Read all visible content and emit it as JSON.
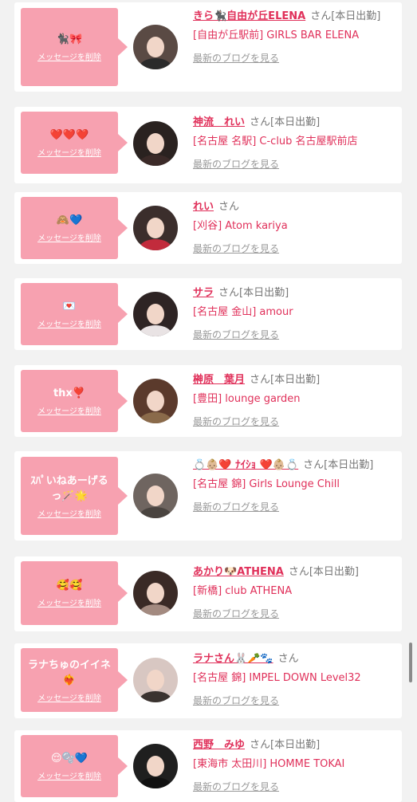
{
  "delete_label": "メッセージを削除",
  "blog_label": "最新のブログを見る",
  "colors": {
    "accent": "#e0305a",
    "bubble": "#f7a1b0",
    "muted": "#777777",
    "card": "#ffffff",
    "background": "#f2f2f2"
  },
  "items": [
    {
      "message": "🐈‍⬛🎀",
      "name": "きら🐈‍⬛自由が丘ELENA",
      "suffix": "さん[本日出勤]",
      "shop": "[自由が丘駅前] GIRLS BAR ELENA",
      "avatar_hair": "#5a4a44",
      "avatar_body": "#2b2b2b"
    },
    {
      "message": "❤️❤️❤️",
      "name": "神流　れい",
      "suffix": "さん[本日出勤]",
      "shop": "[名古屋 名駅] C-club 名古屋駅前店",
      "avatar_hair": "#2a2220",
      "avatar_body": "#3b2a28"
    },
    {
      "message": "🙈💙",
      "name": "れい",
      "suffix": "さん",
      "shop": "[刈谷] Atom kariya",
      "avatar_hair": "#3b2e2c",
      "avatar_body": "#c22b3c"
    },
    {
      "message": "💌",
      "name": "サラ",
      "suffix": "さん[本日出勤]",
      "shop": "[名古屋 金山] amour",
      "avatar_hair": "#2e2424",
      "avatar_body": "#e9e3e4"
    },
    {
      "message": "thx❣️",
      "name": "榊原　葉月",
      "suffix": "さん[本日出勤]",
      "shop": "[豊田] lounge garden",
      "avatar_hair": "#5b3a2c",
      "avatar_body": "#8a6a4a"
    },
    {
      "message": "ｽﾊﾟいねあーげるっ🪄🌟",
      "name": "💍👶🏼❤️ ﾅｲｼｮ ❤️👶🏼💍",
      "suffix": "さん[本日出勤]",
      "shop": "[名古屋 錦] Girls Lounge Chill",
      "avatar_hair": "#6f6560",
      "avatar_body": "#4a4440"
    },
    {
      "message": "🥰🥰",
      "name": "あかり🐶ATHENA",
      "suffix": "さん[本日出勤]",
      "shop": "[新橋] club ATHENA",
      "avatar_hair": "#3a2a26",
      "avatar_body": "#a38a80"
    },
    {
      "message": "ラナちゅのイイネ❤️‍🔥",
      "name": "ラナさん🐰🥕🐾",
      "suffix": "さん",
      "shop": "[名古屋 錦] IMPEL DOWN Level32",
      "avatar_hair": "#d8c7c2",
      "avatar_body": "#3a3330"
    },
    {
      "message": "😌🫧💙",
      "name": "西野　みゆ",
      "suffix": "さん[本日出勤]",
      "shop": "[東海市 太田川] HOMME TOKAI",
      "avatar_hair": "#1f1f1f",
      "avatar_body": "#111111"
    }
  ]
}
